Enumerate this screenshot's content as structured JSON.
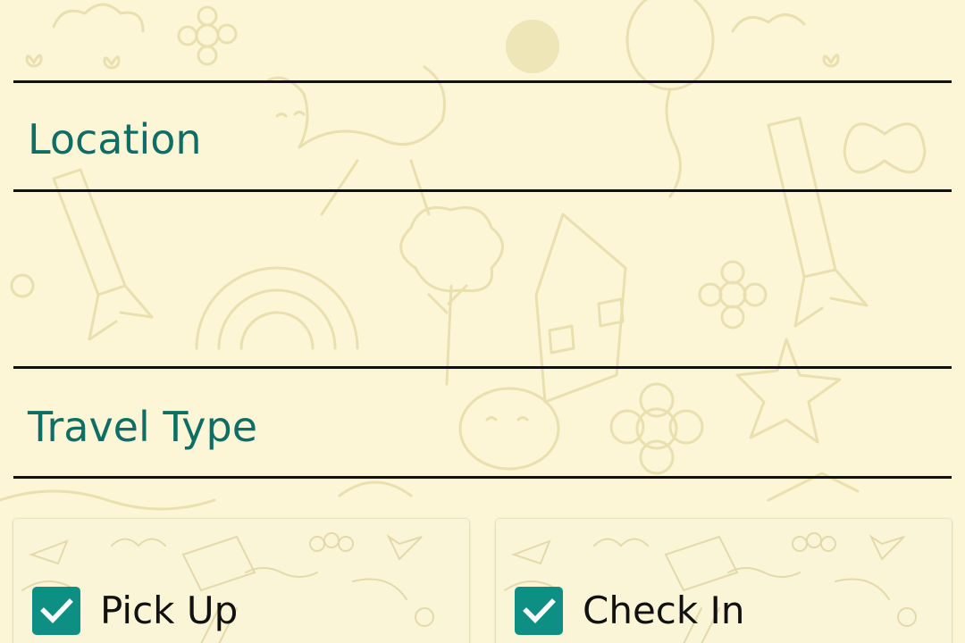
{
  "theme": {
    "background": "#fcf6d6",
    "accent": "#0e8f83",
    "label_color": "#0e6e66",
    "rule_color": "#111111"
  },
  "form": {
    "location_label": "Location",
    "travel_type_label": "Travel Type"
  },
  "options": {
    "pick_up": {
      "label": "Pick Up",
      "checked": true,
      "icon": "checkmark-icon"
    },
    "check_in": {
      "label": "Check In",
      "checked": true,
      "icon": "checkmark-icon"
    }
  }
}
